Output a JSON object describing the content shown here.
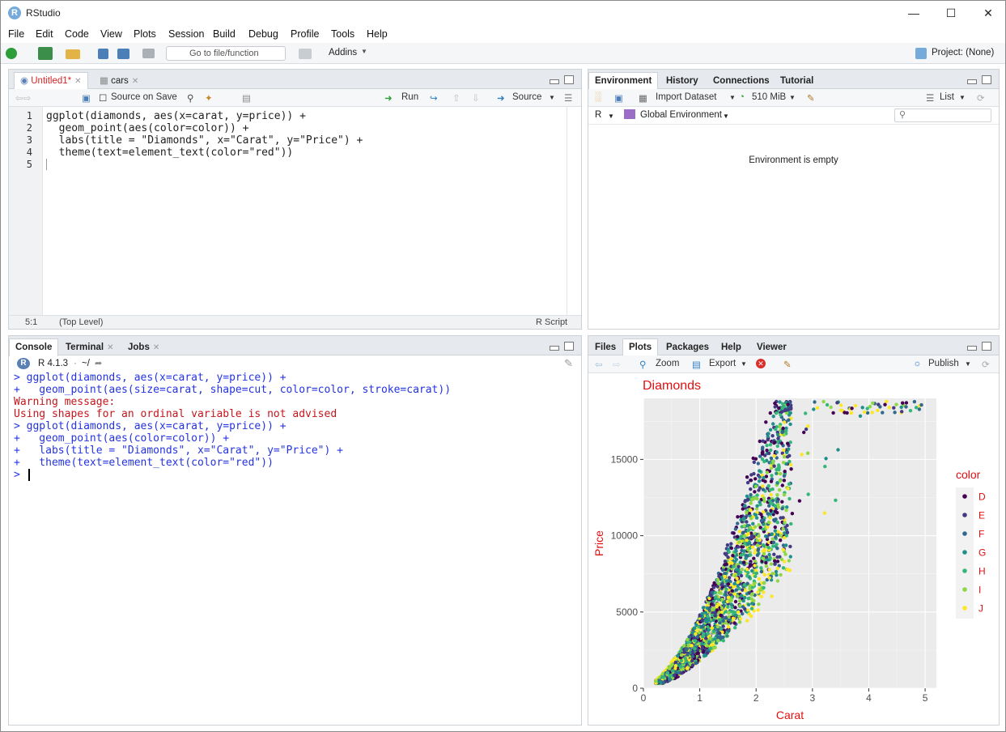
{
  "window": {
    "title": "RStudio",
    "icon_letter": "R"
  },
  "menu": [
    "File",
    "Edit",
    "Code",
    "View",
    "Plots",
    "Session",
    "Build",
    "Debug",
    "Profile",
    "Tools",
    "Help"
  ],
  "toolbar": {
    "goto_placeholder": "Go to file/function",
    "addins": "Addins",
    "project": "Project: (None)"
  },
  "editor": {
    "tabs": [
      {
        "label": "Untitled1*",
        "active": true
      },
      {
        "label": "cars",
        "active": false
      }
    ],
    "source_on_save": "Source on Save",
    "run": "Run",
    "source": "Source",
    "lines": [
      "ggplot(diamonds, aes(x=carat, y=price)) +",
      "  geom_point(aes(color=color)) +",
      "  labs(title = \"Diamonds\", x=\"Carat\", y=\"Price\") +",
      "  theme(text=element_text(color=\"red\"))",
      ""
    ],
    "line_numbers": [
      "1",
      "2",
      "3",
      "4",
      "5"
    ],
    "cursor_pos": "5:1",
    "scope": "(Top Level)",
    "file_type": "R Script"
  },
  "env_pane": {
    "tabs": [
      "Environment",
      "History",
      "Connections",
      "Tutorial"
    ],
    "import_dataset": "Import Dataset",
    "memory": "510 MiB",
    "list_view": "List",
    "language": "R",
    "scope": "Global Environment",
    "empty_message": "Environment is empty"
  },
  "console": {
    "tabs": [
      "Console",
      "Terminal",
      "Jobs"
    ],
    "version": "R 4.1.3",
    "path": "~/",
    "lines": [
      {
        "text": "> ggplot(diamonds, aes(x=carat, y=price)) +",
        "kind": "input"
      },
      {
        "text": "+   geom_point(aes(size=carat, shape=cut, color=color, stroke=carat))",
        "kind": "input"
      },
      {
        "text": "Warning message:",
        "kind": "error"
      },
      {
        "text": "Using shapes for an ordinal variable is not advised",
        "kind": "error"
      },
      {
        "text": "> ggplot(diamonds, aes(x=carat, y=price)) +",
        "kind": "input"
      },
      {
        "text": "+   geom_point(aes(color=color)) +",
        "kind": "input"
      },
      {
        "text": "+   labs(title = \"Diamonds\", x=\"Carat\", y=\"Price\") +",
        "kind": "input"
      },
      {
        "text": "+   theme(text=element_text(color=\"red\"))",
        "kind": "input"
      },
      {
        "text": "> ",
        "kind": "input"
      }
    ]
  },
  "plots_pane": {
    "tabs": [
      "Files",
      "Plots",
      "Packages",
      "Help",
      "Viewer"
    ],
    "zoom": "Zoom",
    "export": "Export",
    "publish": "Publish"
  },
  "chart_data": {
    "type": "scatter",
    "title": "Diamonds",
    "xlabel": "Carat",
    "ylabel": "Price",
    "xlim": [
      0,
      5.2
    ],
    "ylim": [
      0,
      19000
    ],
    "xticks": [
      0,
      1,
      2,
      3,
      4,
      5
    ],
    "yticks": [
      0,
      5000,
      10000,
      15000
    ],
    "legend_title": "color",
    "legend_position": "right",
    "text_color": "#e01010",
    "series": [
      {
        "name": "D",
        "color": "#440154"
      },
      {
        "name": "E",
        "color": "#443a83"
      },
      {
        "name": "F",
        "color": "#31688e"
      },
      {
        "name": "G",
        "color": "#21908c"
      },
      {
        "name": "H",
        "color": "#35b779"
      },
      {
        "name": "I",
        "color": "#8fd744"
      },
      {
        "name": "J",
        "color": "#fde725"
      }
    ]
  }
}
